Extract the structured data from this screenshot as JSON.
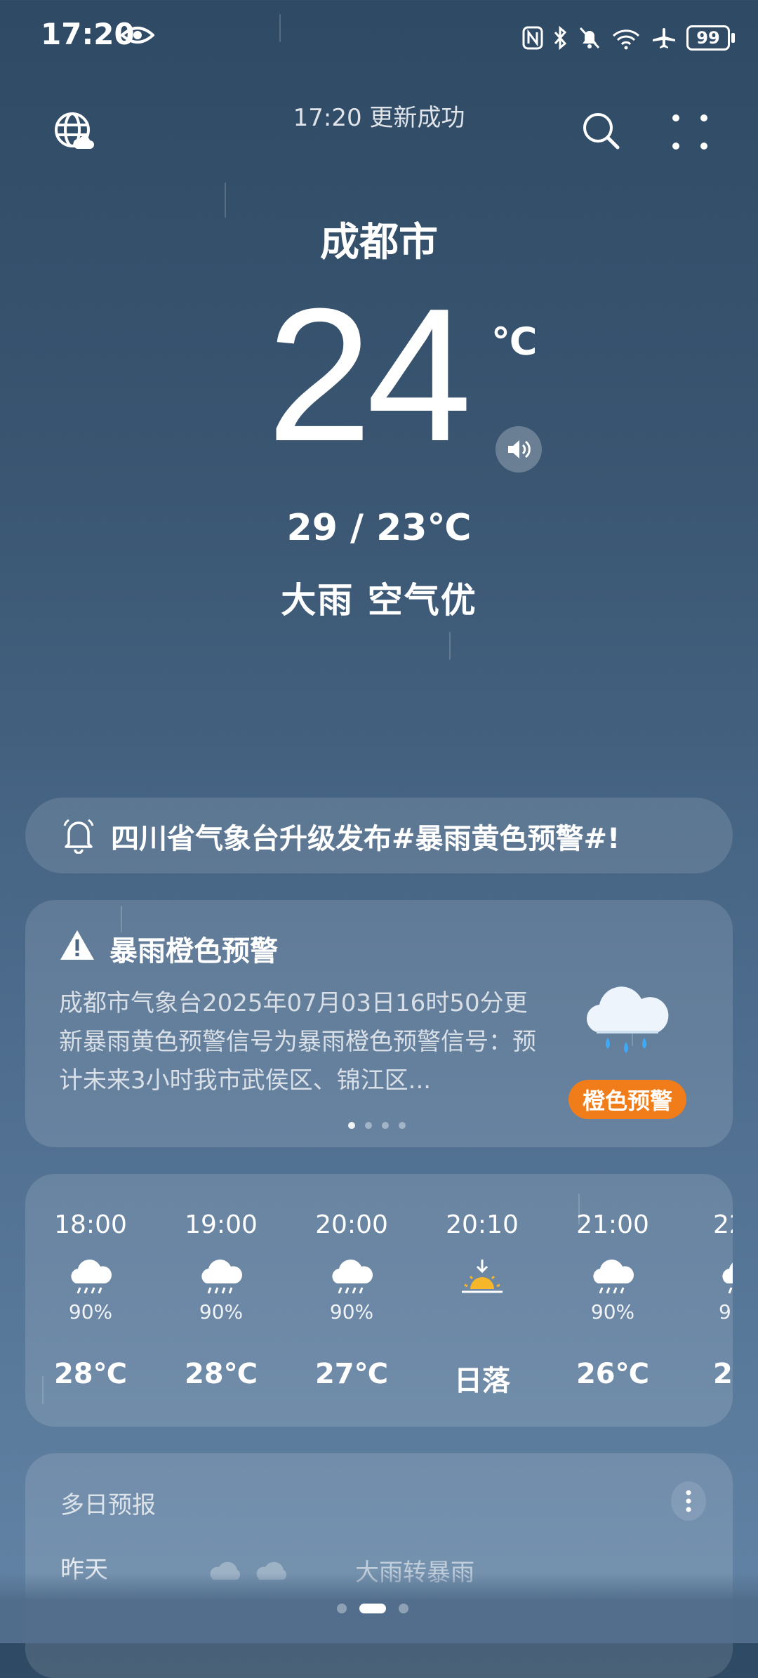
{
  "status_bar": {
    "time": "17:20",
    "battery": "99"
  },
  "header": {
    "update_text": "17:20 更新成功"
  },
  "current": {
    "city": "成都市",
    "temperature": "24",
    "unit": "℃",
    "range": "29 / 23℃",
    "condition": "大雨  空气优"
  },
  "alert_bar": {
    "text": "四川省气象台升级发布#暴雨黄色预警#!"
  },
  "warning": {
    "title": "暴雨橙色预警",
    "body": "成都市气象台2025年07月03日16时50分更新暴雨黄色预警信号为暴雨橙色预警信号：预计未来3小时我市武侯区、锦江区...",
    "badge": "橙色预警",
    "badge_color": "#f07c1a"
  },
  "hourly": [
    {
      "time": "18:00",
      "icon": "rain-cloud-icon",
      "precip": "90%",
      "temp": "28℃"
    },
    {
      "time": "19:00",
      "icon": "rain-cloud-icon",
      "precip": "90%",
      "temp": "28℃"
    },
    {
      "time": "20:00",
      "icon": "rain-cloud-icon",
      "precip": "90%",
      "temp": "27℃"
    },
    {
      "time": "20:10",
      "icon": "sunset-icon",
      "precip": "",
      "temp": "日落"
    },
    {
      "time": "21:00",
      "icon": "rain-cloud-icon",
      "precip": "90%",
      "temp": "26℃"
    },
    {
      "time": "22",
      "icon": "rain-cloud-icon",
      "precip": "9",
      "temp": "2"
    }
  ],
  "multi_day": {
    "title": "多日预报",
    "first_day": "昨天",
    "first_condition": "大雨转暴雨"
  }
}
